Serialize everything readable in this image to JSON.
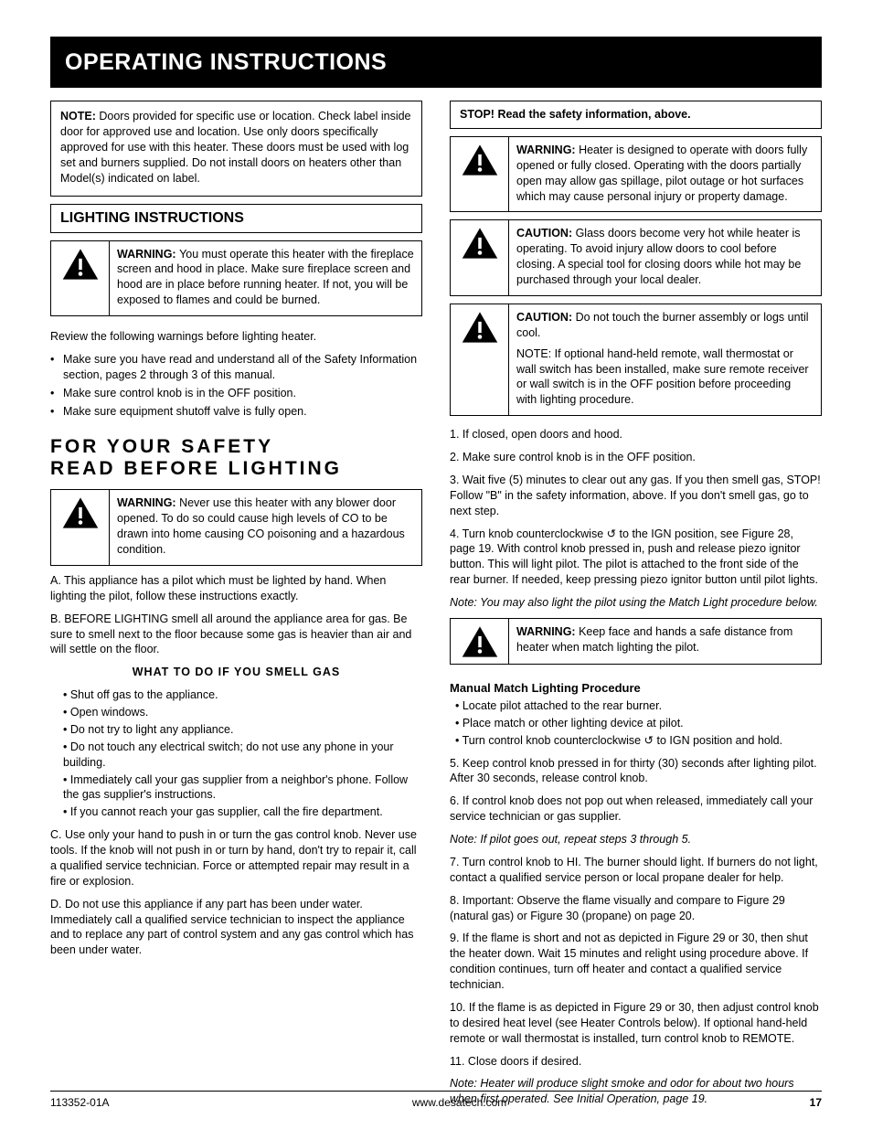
{
  "titlebar": "OPERATING INSTRUCTIONS",
  "left": {
    "note_heading": "NOTE: ",
    "note_text": "Doors provided for specific use or location. Check label inside door for approved use and location. Use only doors specifically approved for use with this heater. These doors must be used with log set and burners supplied. Do not install doors on heaters other than Model(s) indicated on label.",
    "lighting_head": "LIGHTING INSTRUCTIONS",
    "warn1_level": "WARNING: ",
    "warn1_text": "You must operate this heater with the fireplace screen and hood in place. Make sure fireplace screen and hood are in place before running heater. If not, you will be exposed to flames and could be burned.",
    "intro1": "Review the following warnings before lighting heater.",
    "bullets1": [
      "Make sure you have read and understand all of the Safety Information section, pages 2 through 3 of this manual.",
      "Make sure control knob is in the OFF position.",
      "Make sure equipment shutoff valve is fully open."
    ],
    "warn2_level": "WARNING: ",
    "warn2_text": "Never use this heater with any blower door opened. To do so could cause high levels of CO to be drawn into home causing CO poisoning and a hazardous condition.",
    "after_warn2": [
      "A. This appliance has a pilot which must be lighted by hand. When lighting the pilot, follow these instructions exactly.",
      "B. BEFORE LIGHTING smell all around the appliance area for gas. Be sure to smell next to the floor because some gas is heavier than air and will settle on the floor.",
      "WHAT TO DO IF YOU SMELL GAS",
      "• Shut off gas to the appliance.",
      "• Open windows.",
      "• Do not try to light any appliance.",
      "• Do not touch any electrical switch; do not use any phone in your building.",
      "• Immediately call your gas supplier from a neighbor's phone. Follow the gas supplier's instructions.",
      "• If you cannot reach your gas supplier, call the fire department.",
      "C. Use only your hand to push in or turn the gas control knob. Never use tools. If the knob will not push in or turn by hand, don't try to repair it, call a qualified service technician. Force or attempted repair may result in a fire or explosion.",
      "D. Do not use this appliance if any part has been under water. Immediately call a qualified service technician to inspect the appliance and to replace any part of control system and any gas control which has been under water."
    ]
  },
  "right": {
    "stopbox": "STOP! Read the safety information, above.",
    "warn3_level": "WARNING: ",
    "warn3_text": "Heater is designed to operate with doors fully opened or fully closed. Operating with the doors partially open may allow gas spillage, pilot outage or hot surfaces which may cause personal injury or property damage.",
    "warn4_level": "CAUTION: ",
    "warn4_text": "Glass doors become very hot while heater is operating. To avoid injury allow doors to cool before closing. A special tool for closing doors while hot may be purchased through your local dealer.",
    "warn5_level": "CAUTION: ",
    "warn5_text1": "Do not touch the burner assembly or logs until cool.",
    "warn5_text2": "NOTE: If optional hand-held remote, wall thermostat or wall switch has been installed, make sure remote receiver or wall switch is in the OFF position before proceeding with lighting procedure.",
    "steps": [
      "1. If closed, open doors and hood.",
      "2. Make sure control knob is in the OFF position.",
      "3. Wait five (5) minutes to clear out any gas. If you then smell gas, STOP! Follow \"B\" in the safety information, above. If you don't smell gas, go to next step.",
      "4. Turn knob counterclockwise ↺ to the IGN position, see Figure 28, page 19. With control knob pressed in, push and release piezo ignitor button. This will light pilot. The pilot is attached to the front side of the rear burner. If needed, keep pressing piezo ignitor button until pilot lights."
    ],
    "note2": "Note: You may also light the pilot using the Match Light procedure below.",
    "warn6_level": "WARNING: ",
    "warn6_text": "Keep face and hands a safe distance from heater when match lighting the pilot.",
    "match_head": "Manual Match Lighting Procedure",
    "match_steps": [
      "• Locate pilot attached to the rear burner.",
      "• Place match or other lighting device at pilot.",
      "• Turn control knob counterclockwise ↺ to IGN position and hold."
    ],
    "steps2": [
      "5. Keep control knob pressed in for thirty (30) seconds after lighting pilot. After 30 seconds, release control knob.",
      "6. If control knob does not pop out when released, immediately call your service technician or gas supplier.",
      "Note: If pilot goes out, repeat steps 3 through 5.",
      "7. Turn control knob to HI. The burner should light. If burners do not light, contact a qualified service person or local propane dealer for help.",
      "8. Important: Observe the flame visually and compare to Figure 29 (natural gas) or Figure 30 (propane) on page 20.",
      "9. If the flame is short and not as depicted in Figure 29 or 30, then shut the heater down. Wait 15 minutes and relight using procedure above. If condition continues, turn off heater and contact a qualified service technician.",
      "10. If the flame is as depicted in Figure 29 or 30, then adjust control knob to desired heat level (see Heater Controls below). If optional hand-held remote or wall thermostat is installed, turn control knob to REMOTE.",
      "11. Close doors if desired.",
      "Note: Heater will produce slight smoke and odor for about two hours when first operated. See Initial Operation, page 19."
    ]
  },
  "footer": {
    "left": "113352-01A",
    "right_pre": "www.desatech.com",
    "pagenum": "17"
  }
}
